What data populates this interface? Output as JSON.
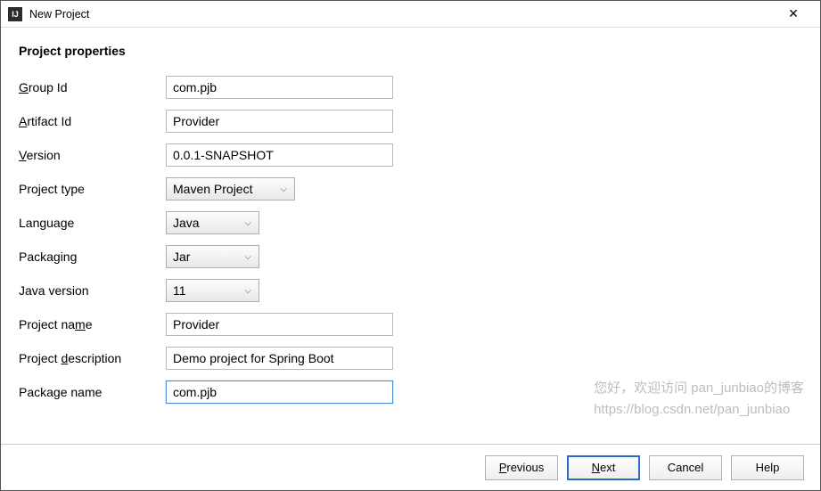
{
  "window": {
    "title": "New Project",
    "icon_text": "IJ"
  },
  "header": {
    "title": "Project properties"
  },
  "form": {
    "group_id": {
      "label_pre": "",
      "label_mnemonic": "G",
      "label_post": "roup Id",
      "value": "com.pjb"
    },
    "artifact_id": {
      "label_pre": "",
      "label_mnemonic": "A",
      "label_post": "rtifact Id",
      "value": "Provider"
    },
    "version": {
      "label_pre": "",
      "label_mnemonic": "V",
      "label_post": "ersion",
      "value": "0.0.1-SNAPSHOT"
    },
    "project_type": {
      "label": "Project type",
      "value": "Maven Project"
    },
    "language": {
      "label": "Language",
      "value": "Java"
    },
    "packaging": {
      "label": "Packaging",
      "value": "Jar"
    },
    "java_version": {
      "label": "Java version",
      "value": "11"
    },
    "project_name": {
      "label_pre": "Project na",
      "label_mnemonic": "m",
      "label_post": "e",
      "value": "Provider"
    },
    "project_description": {
      "label_pre": "Project ",
      "label_mnemonic": "d",
      "label_post": "escription",
      "value": "Demo project for Spring Boot"
    },
    "package_name": {
      "label_pre": "Packa",
      "label_mnemonic": "g",
      "label_post": "e name",
      "value": "com.pjb"
    }
  },
  "watermark": {
    "line1": "您好，欢迎访问 pan_junbiao的博客",
    "line2": "https://blog.csdn.net/pan_junbiao"
  },
  "buttons": {
    "previous": {
      "mnemonic": "P",
      "rest": "revious"
    },
    "next": {
      "mnemonic": "N",
      "rest": "ext"
    },
    "cancel": {
      "text": "Cancel"
    },
    "help": {
      "text": "Help"
    }
  }
}
